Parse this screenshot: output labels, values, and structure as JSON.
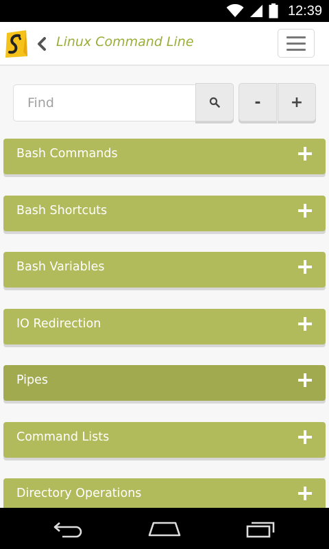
{
  "status_bar": {
    "time": "12:39",
    "icons": [
      "wifi-icon",
      "signal-icon",
      "battery-icon"
    ]
  },
  "header": {
    "title": "Linux Command Line",
    "icons": [
      "app-logo",
      "back-chevron-icon",
      "hamburger-menu-icon"
    ]
  },
  "search": {
    "placeholder": "Find",
    "value": "",
    "icon": "search-icon"
  },
  "zoom": {
    "minus_label": "-",
    "plus_label": "+"
  },
  "sections": [
    {
      "label": "Bash Commands",
      "active": false
    },
    {
      "label": "Bash Shortcuts",
      "active": false
    },
    {
      "label": "Bash Variables",
      "active": false
    },
    {
      "label": "IO Redirection",
      "active": false
    },
    {
      "label": "Pipes",
      "active": true
    },
    {
      "label": "Command Lists",
      "active": false
    },
    {
      "label": "Directory Operations",
      "active": false
    }
  ],
  "nav_bar": {
    "icons": [
      "back-icon",
      "home-icon",
      "recents-icon"
    ]
  },
  "colors": {
    "accent": "#9aad3a",
    "section_bg": "#b2bb5b",
    "section_active_bg": "#a2aa4f",
    "page_bg": "#f7f7f7"
  }
}
